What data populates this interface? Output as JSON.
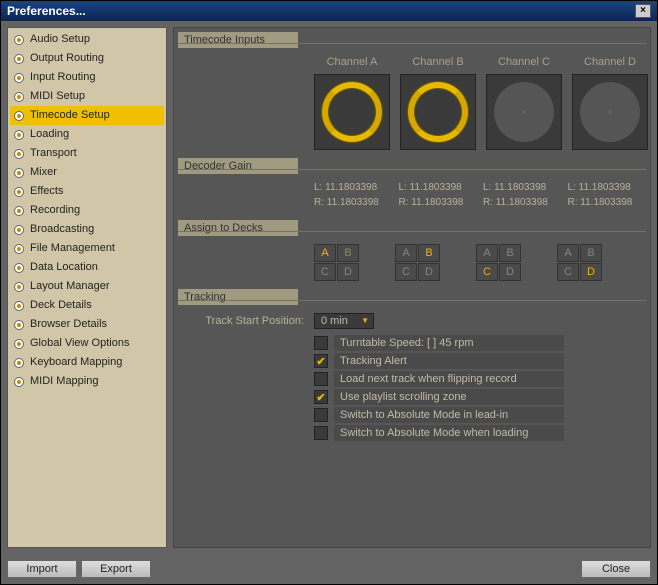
{
  "window": {
    "title": "Preferences..."
  },
  "sidebar": {
    "items": [
      {
        "label": "Audio Setup"
      },
      {
        "label": "Output Routing"
      },
      {
        "label": "Input Routing"
      },
      {
        "label": "MIDI Setup"
      },
      {
        "label": "Timecode Setup",
        "selected": true
      },
      {
        "label": "Loading"
      },
      {
        "label": "Transport"
      },
      {
        "label": "Mixer"
      },
      {
        "label": "Effects"
      },
      {
        "label": "Recording"
      },
      {
        "label": "Broadcasting"
      },
      {
        "label": "File Management"
      },
      {
        "label": "Data Location"
      },
      {
        "label": "Layout Manager"
      },
      {
        "label": "Deck Details"
      },
      {
        "label": "Browser Details"
      },
      {
        "label": "Global View Options"
      },
      {
        "label": "Keyboard Mapping"
      },
      {
        "label": "MIDI Mapping"
      }
    ]
  },
  "sections": {
    "timecode_inputs": "Timecode Inputs",
    "decoder_gain": "Decoder Gain",
    "assign_to_decks": "Assign to Decks",
    "tracking": "Tracking"
  },
  "channels": [
    {
      "label": "Channel A",
      "signal": true
    },
    {
      "label": "Channel B",
      "signal": true
    },
    {
      "label": "Channel C",
      "signal": false
    },
    {
      "label": "Channel D",
      "signal": false
    }
  ],
  "gain": [
    {
      "l": "L: 11.1803398",
      "r": "R: 11.1803398"
    },
    {
      "l": "L: 11.1803398",
      "r": "R: 11.1803398"
    },
    {
      "l": "L: 11.1803398",
      "r": "R: 11.1803398"
    },
    {
      "l": "L: 11.1803398",
      "r": "R: 11.1803398"
    }
  ],
  "assign": {
    "letters": [
      "A",
      "B",
      "C",
      "D"
    ],
    "groups": [
      {
        "active": "A"
      },
      {
        "active": "B"
      },
      {
        "active": "C"
      },
      {
        "active": "D"
      }
    ]
  },
  "tracking": {
    "start_label": "Track Start Position:",
    "start_value": "0 min",
    "options": [
      {
        "label": "Turntable Speed: [ ] 45 rpm",
        "checked": false
      },
      {
        "label": "Tracking Alert",
        "checked": true
      },
      {
        "label": "Load next track when flipping record",
        "checked": false
      },
      {
        "label": "Use playlist scrolling zone",
        "checked": true
      },
      {
        "label": "Switch to Absolute Mode in lead-in",
        "checked": false
      },
      {
        "label": "Switch to Absolute Mode when loading",
        "checked": false
      }
    ]
  },
  "footer": {
    "import": "Import",
    "export": "Export",
    "close": "Close"
  }
}
